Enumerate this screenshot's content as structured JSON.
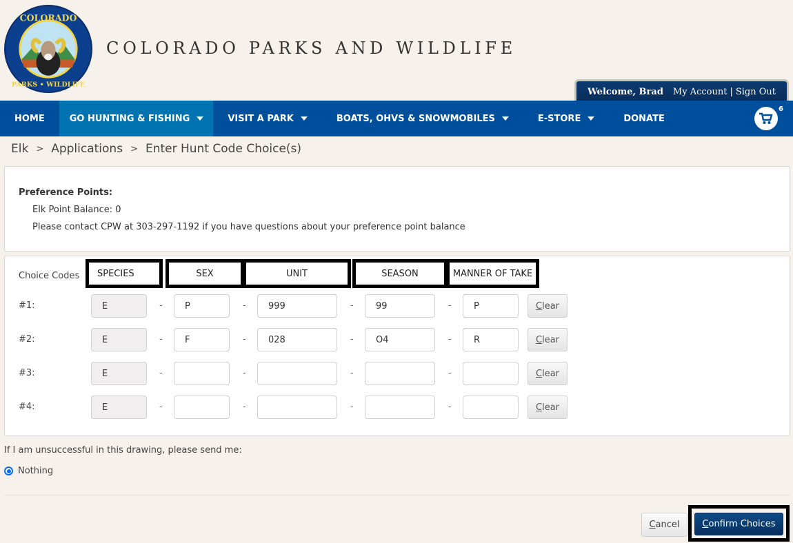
{
  "header": {
    "logo_alt": "Colorado Parks & Wildlife logo",
    "logo_text_top": "COLORADO",
    "logo_text_bottom": "PARKS • WILDLIFE",
    "site_title": "COLORADO PARKS AND WILDLIFE",
    "account": {
      "welcome": "Welcome, Brad",
      "my_account": "My Account",
      "separator": "|",
      "sign_out": "Sign Out"
    }
  },
  "nav": {
    "items": [
      {
        "label": "HOME",
        "has_dropdown": false,
        "active": false
      },
      {
        "label": "GO HUNTING & FISHING",
        "has_dropdown": true,
        "active": true
      },
      {
        "label": "VISIT A PARK",
        "has_dropdown": true,
        "active": false
      },
      {
        "label": "BOATS, OHVS & SNOWMOBILES",
        "has_dropdown": true,
        "active": false
      },
      {
        "label": "E-STORE",
        "has_dropdown": true,
        "active": false
      },
      {
        "label": "DONATE",
        "has_dropdown": false,
        "active": false
      }
    ],
    "cart": {
      "icon": "cart-icon",
      "count": "6"
    }
  },
  "breadcrumb": {
    "items": [
      "Elk",
      "Applications",
      "Enter Hunt Code Choice(s)"
    ],
    "separator": ">"
  },
  "preference_points": {
    "title": "Preference Points:",
    "balance": "Elk Point Balance: 0",
    "contact": "Please contact CPW at 303-297-1192 if you have questions about your preference point balance"
  },
  "choice_codes": {
    "label": "Choice Codes",
    "columns": [
      "SPECIES",
      "SEX",
      "UNIT",
      "SEASON",
      "MANNER OF TAKE"
    ],
    "separator": "-",
    "clear_label_first": "C",
    "clear_label_rest": "lear",
    "rows": [
      {
        "label": "#1:",
        "species": "E",
        "sex": "P",
        "unit": "999",
        "season": "99",
        "manner": "P"
      },
      {
        "label": "#2:",
        "species": "E",
        "sex": "F",
        "unit": "028",
        "season": "O4",
        "manner": "R"
      },
      {
        "label": "#3:",
        "species": "E",
        "sex": "",
        "unit": "",
        "season": "",
        "manner": ""
      },
      {
        "label": "#4:",
        "species": "E",
        "sex": "",
        "unit": "",
        "season": "",
        "manner": ""
      }
    ]
  },
  "unsuccessful": {
    "prompt": "If I am unsuccessful in this drawing, please send me:",
    "options": [
      {
        "label": "Nothing",
        "selected": true
      }
    ]
  },
  "actions": {
    "cancel_first": "C",
    "cancel_rest": "ancel",
    "confirm_first": "C",
    "confirm_rest": "onfirm Choices"
  },
  "colors": {
    "nav_bg": "#004f9c",
    "nav_active": "#0073b0",
    "account_tab": "#0b3a6f",
    "confirm_button": "#0a3e75",
    "page_bg": "#f6f2eb"
  }
}
